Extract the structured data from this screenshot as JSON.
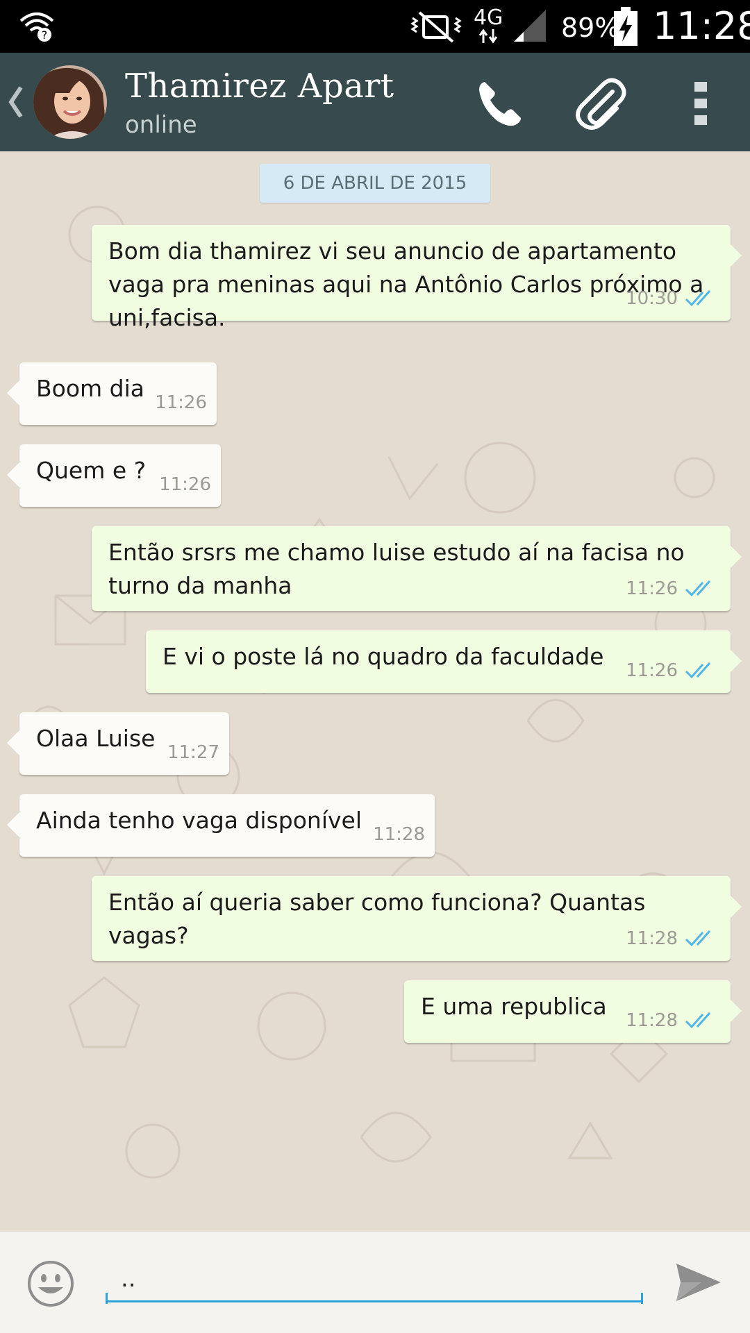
{
  "status_bar": {
    "network": "4G",
    "battery": "89%",
    "time": "11:28"
  },
  "header": {
    "contact_name": "Thamirez Apart",
    "contact_status": "online",
    "icons": [
      "back-icon",
      "phone-icon",
      "paperclip-icon",
      "overflow-menu-icon"
    ]
  },
  "chat": {
    "date": "6 DE ABRIL DE 2015",
    "messages": [
      {
        "dir": "out",
        "text": "Bom dia thamirez vi seu anuncio de apartamento vaga pra meninas aqui na Antônio Carlos próximo a uni,facisa.",
        "time": "10:30",
        "status": "read"
      },
      {
        "dir": "in",
        "text": "Boom dia",
        "time": "11:26"
      },
      {
        "dir": "in",
        "text": "Quem e ?",
        "time": "11:26"
      },
      {
        "dir": "out",
        "text": "Então srsrs me chamo luise estudo aí na facisa no turno da manha",
        "time": "11:26",
        "status": "read"
      },
      {
        "dir": "out",
        "text": "E vi o poste lá no quadro da faculdade",
        "time": "11:26",
        "status": "read"
      },
      {
        "dir": "in",
        "text": "Olaa Luise",
        "time": "11:27"
      },
      {
        "dir": "in",
        "text": "Ainda tenho vaga disponível",
        "time": "11:28"
      },
      {
        "dir": "out",
        "text": "Então aí queria saber como funciona? Quantas vagas?",
        "time": "11:28",
        "status": "read"
      },
      {
        "dir": "out",
        "text": "E uma republica",
        "time": "11:28",
        "status": "read"
      }
    ]
  },
  "composer": {
    "value": ".."
  },
  "colors": {
    "header": "#374a4d",
    "outgoing_bubble": "#f0fde1",
    "incoming_bubble": "#fcfbf8",
    "read_ticks": "#4fb6e6",
    "input_underline": "#2aa3d8"
  }
}
